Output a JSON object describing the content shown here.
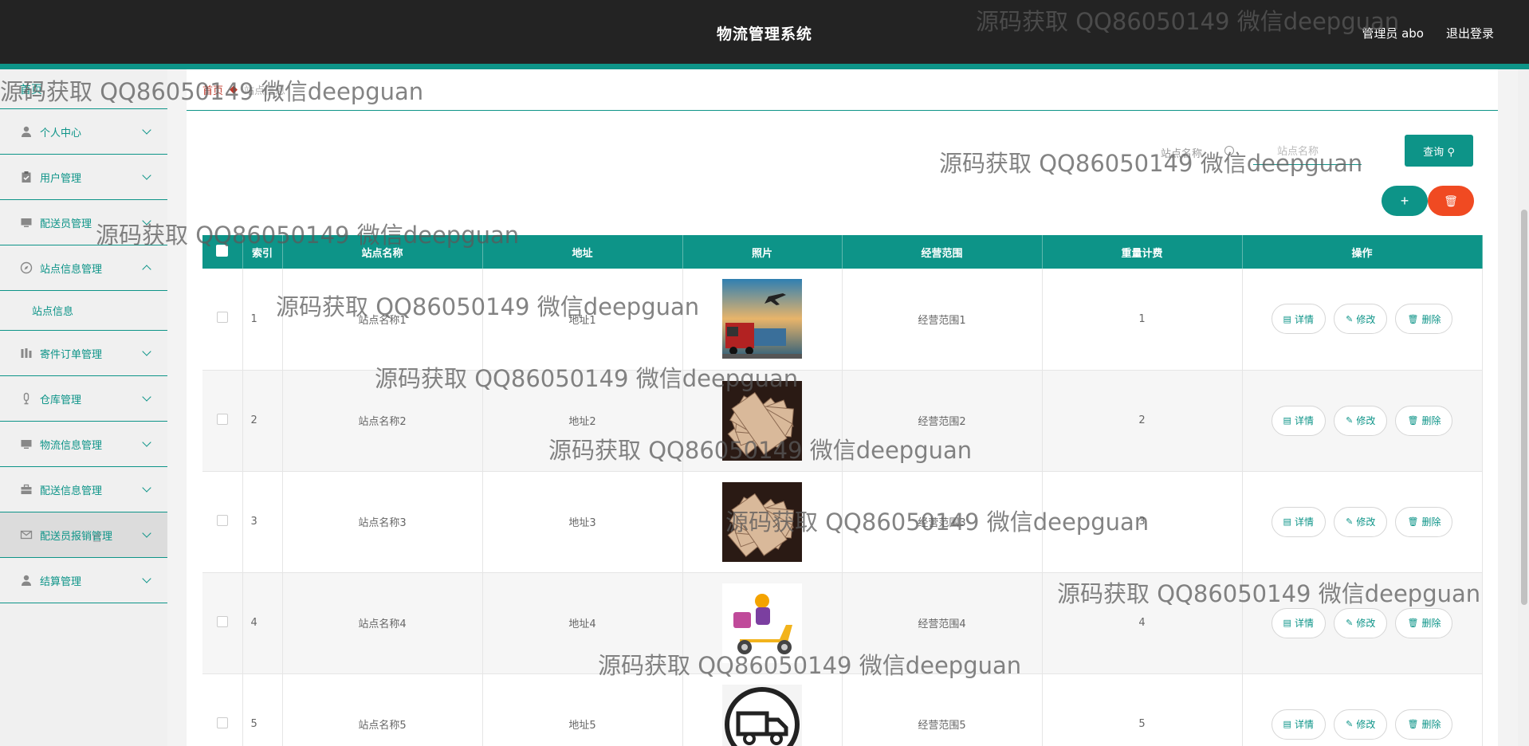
{
  "header": {
    "title": "物流管理系统",
    "user": "管理员 abo",
    "logout": "退出登录"
  },
  "sidebar": {
    "home": "首页",
    "items": [
      {
        "label": "个人中心",
        "icon": "person-icon"
      },
      {
        "label": "用户管理",
        "icon": "clipboard-icon"
      },
      {
        "label": "配送员管理",
        "icon": "monitor-icon"
      },
      {
        "label": "站点信息管理",
        "icon": "compass-icon",
        "expanded": true,
        "children": [
          "站点信息"
        ]
      },
      {
        "label": "寄件订单管理",
        "icon": "bars-icon"
      },
      {
        "label": "仓库管理",
        "icon": "mic-icon"
      },
      {
        "label": "物流信息管理",
        "icon": "monitor-icon"
      },
      {
        "label": "配送信息管理",
        "icon": "briefcase-icon"
      },
      {
        "label": "配送员报销管理",
        "icon": "mail-icon"
      },
      {
        "label": "结算管理",
        "icon": "person-icon"
      }
    ]
  },
  "breadcrumb": {
    "home": "首页",
    "current": "站点信息"
  },
  "search": {
    "label": "站点名称",
    "placeholder": "站点名称",
    "button": "查询"
  },
  "table": {
    "headers": [
      "索引",
      "站点名称",
      "地址",
      "照片",
      "经营范围",
      "重量计费",
      "操作"
    ],
    "rows": [
      {
        "idx": "1",
        "name": "站点名称1",
        "addr": "地址1",
        "photo": "plane-truck-photo",
        "scope": "经营范围1",
        "weight": "1"
      },
      {
        "idx": "2",
        "name": "站点名称2",
        "addr": "地址2",
        "photo": "banknotes-photo",
        "scope": "经营范围2",
        "weight": "2"
      },
      {
        "idx": "3",
        "name": "站点名称3",
        "addr": "地址3",
        "photo": "banknotes-photo",
        "scope": "经营范围3",
        "weight": "3"
      },
      {
        "idx": "4",
        "name": "站点名称4",
        "addr": "地址4",
        "photo": "scooter-delivery-photo",
        "scope": "经营范围4",
        "weight": "4"
      },
      {
        "idx": "5",
        "name": "站点名称5",
        "addr": "地址5",
        "photo": "truck-icon-photo",
        "scope": "经营范围5",
        "weight": "5"
      }
    ],
    "actions": {
      "detail": "详情",
      "edit": "修改",
      "delete": "删除"
    }
  },
  "watermark": "源码获取 QQ86050149 微信deepguan",
  "colors": {
    "primary": "#0d9488",
    "danger": "#f04a22",
    "topbar": "#232323"
  }
}
